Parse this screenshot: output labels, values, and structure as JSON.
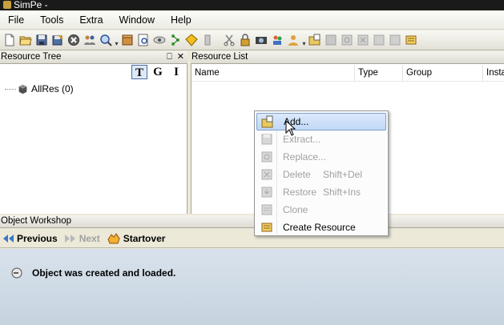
{
  "window": {
    "title": "SimPe -"
  },
  "menu": [
    "File",
    "Tools",
    "Extra",
    "Window",
    "Help"
  ],
  "toolbar": {
    "icons": [
      "new-file-icon",
      "open-folder-icon",
      "save-icon",
      "save-as-icon",
      "close-icon",
      "users-icon",
      "search-icon",
      "separator",
      "package-icon",
      "preview-icon",
      "eye-icon",
      "dna-icon",
      "neighborhood-icon",
      "scroll-icon",
      "separator",
      "scissors-icon",
      "lock-icon",
      "camera-icon",
      "hood-icon",
      "user-icon",
      "separator",
      "add-icon",
      "extract-icon",
      "replace-icon",
      "delete-icon",
      "restore-icon",
      "clone-icon",
      "create-icon"
    ]
  },
  "resource_tree": {
    "title": "Resource Tree",
    "pin_glyph": "⎕",
    "close_glyph": "✕",
    "view_buttons": [
      "T",
      "G",
      "I"
    ],
    "root_label": "AllRes (0)"
  },
  "resource_list": {
    "title": "Resource List",
    "columns": [
      "Name",
      "Type",
      "Group",
      "Insta"
    ]
  },
  "context_menu": {
    "items": [
      {
        "label": "Add...",
        "shortcut": "",
        "enabled": true,
        "hover": true
      },
      {
        "label": "Extract...",
        "shortcut": "",
        "enabled": false
      },
      {
        "label": "Replace...",
        "shortcut": "",
        "enabled": false
      },
      {
        "label": "Delete",
        "shortcut": "Shift+Del",
        "enabled": false
      },
      {
        "label": "Restore",
        "shortcut": "Shift+Ins",
        "enabled": false
      },
      {
        "label": "Clone",
        "shortcut": "",
        "enabled": false
      },
      {
        "label": "Create Resource",
        "shortcut": "",
        "enabled": true
      }
    ]
  },
  "object_workshop": {
    "title": "Object Workshop",
    "previous_label": "Previous",
    "next_label": "Next",
    "startover_label": "Startover",
    "message": "Object was created and loaded."
  },
  "colors": {
    "hover_border": "#7da2ce",
    "workshop_bg": "#c6d3df",
    "disabled_text": "#a0a0a0"
  }
}
